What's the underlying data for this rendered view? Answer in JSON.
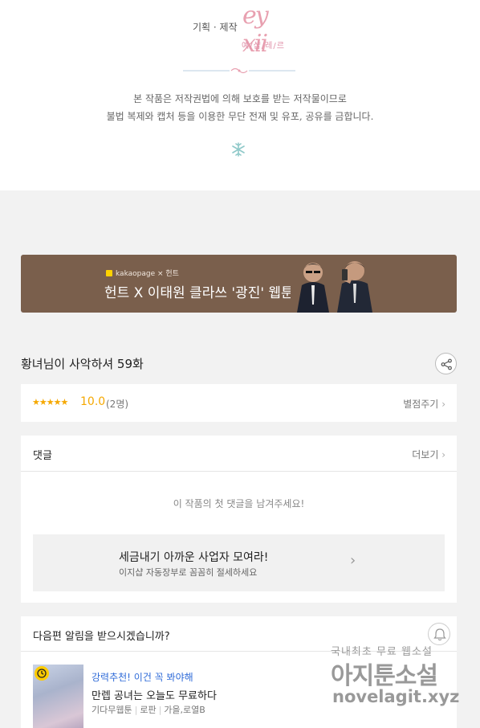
{
  "credits": {
    "label": "기획 · 제작",
    "logo_mark": "ey xii",
    "logo_sub": "예/샵/레/르",
    "notice_line1": "본 작품은 저작권법에 의해 보호를 받는 저작물이므로",
    "notice_line2": "불법 복제와 캡처 등을 이용한 무단 전재 및 유포, 공유를 금합니다.",
    "accent_color": "#e8a0b0"
  },
  "banner": {
    "brand": "kakaopage × 헌트",
    "headline": "헌트 X 이태원 클라쓰 '광진' 웹툰",
    "background": "#7a5f4c"
  },
  "episode": {
    "title": "황녀님이 사악하셔 59화",
    "share_icon": "share-icon"
  },
  "rating": {
    "stars": "★★★★★",
    "score": "10.0",
    "votes": "(2명)",
    "rate_link": "별점주기",
    "star_color": "#f5a800"
  },
  "comments": {
    "title": "댓글",
    "more": "더보기",
    "empty": "이 작품의 첫 댓글을 남겨주세요!",
    "ad_title": "세금내기 아까운 사업자 모여라!",
    "ad_sub": "이지샵 자동장부로 꼼꼼히 절세하세요",
    "ad_arrow": "›"
  },
  "next_episode": {
    "title": "다음편 알림을 받으시겠습니까?",
    "bell_icon": "bell-icon",
    "rec_tag": "강력추천! 이건 꼭 봐야해",
    "rec_name": "만렙 공녀는 오늘도 무료하다",
    "rec_meta": [
      "기다무웹툰",
      "로판",
      "가을,로열B"
    ],
    "tag_color": "#2f6bd8"
  },
  "watermark": {
    "line1a": "국내최초 무료 ",
    "line1b": "웹소설",
    "line2": "아지툰소설",
    "line3": "novelagit.xyz"
  }
}
